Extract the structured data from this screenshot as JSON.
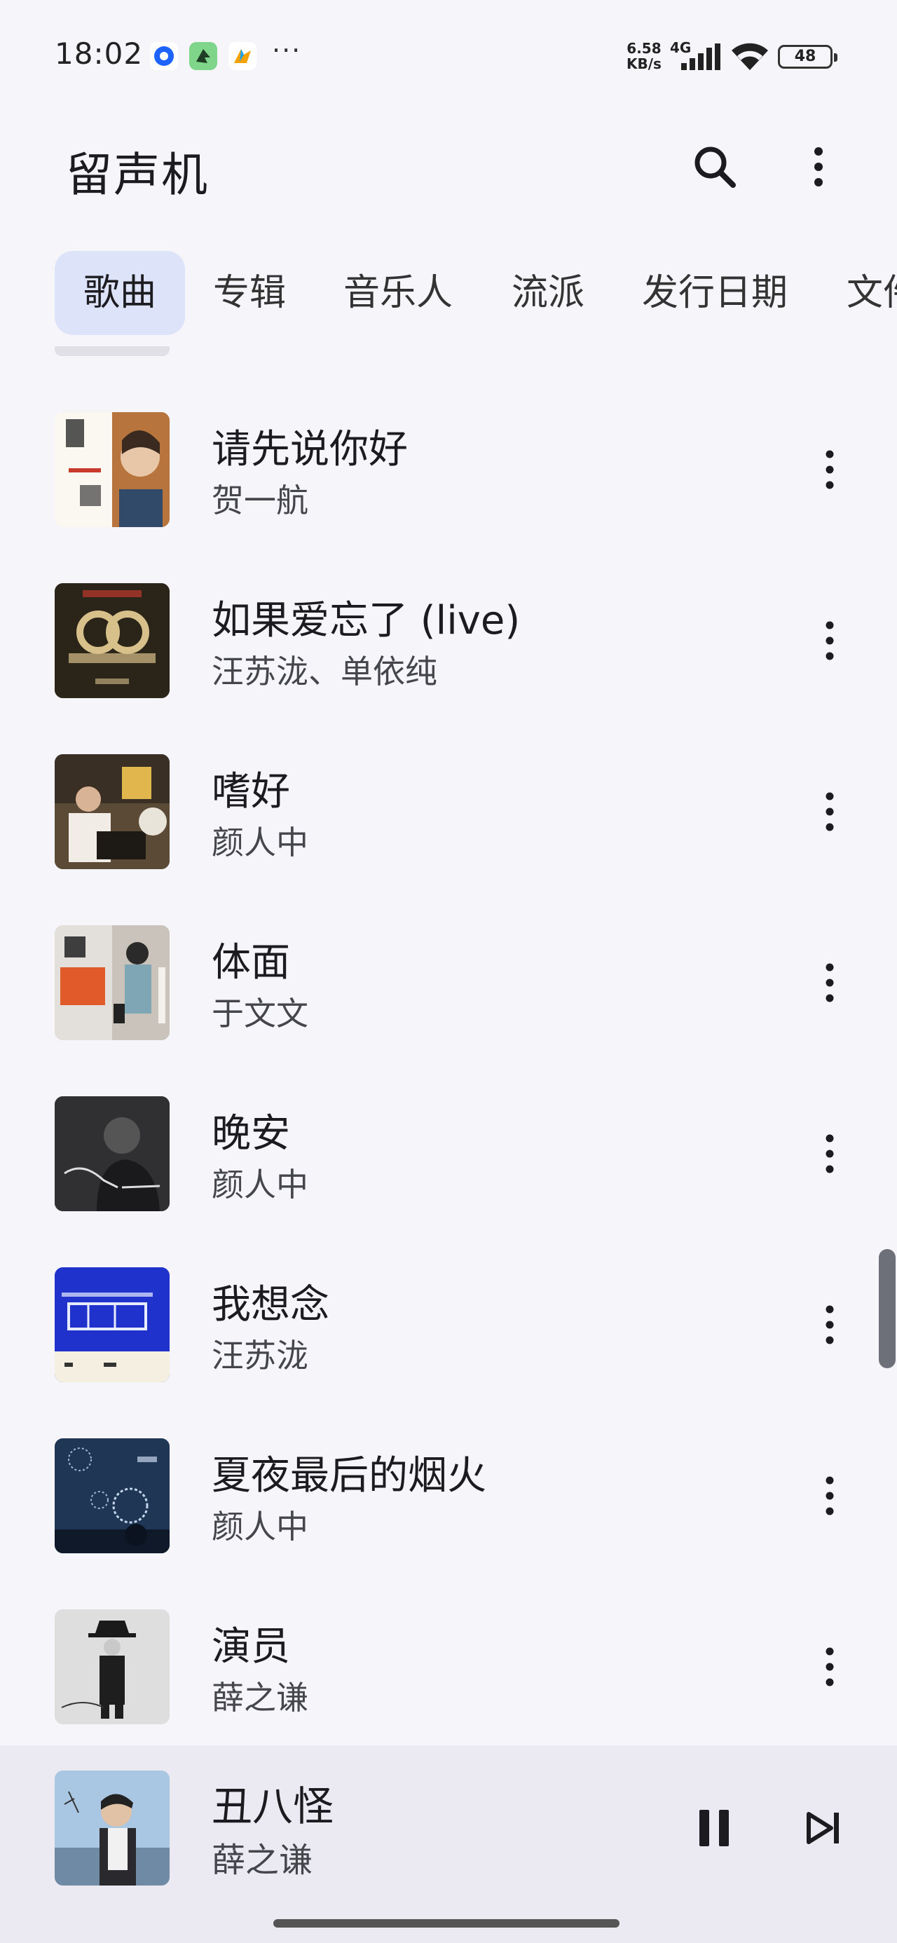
{
  "status_bar": {
    "time": "18:02",
    "net_speed_value": "6.58",
    "net_speed_unit": "KB/s",
    "network_type": "4G",
    "battery": "48",
    "overflow_dots": "···"
  },
  "header": {
    "title": "留声机",
    "search_icon": "search-icon",
    "more_icon": "more-vert-icon"
  },
  "tabs": [
    {
      "label": "歌曲",
      "active": true
    },
    {
      "label": "专辑",
      "active": false
    },
    {
      "label": "音乐人",
      "active": false
    },
    {
      "label": "流派",
      "active": false
    },
    {
      "label": "发行日期",
      "active": false
    },
    {
      "label": "文件夹",
      "active": false
    }
  ],
  "songs": [
    {
      "title": "请先说你好",
      "artist": "贺一航",
      "cover_color": "#e8c9a3"
    },
    {
      "title": "如果爱忘了 (live)",
      "artist": "汪苏泷、单依纯",
      "cover_color": "#2a2418"
    },
    {
      "title": "嗜好",
      "artist": "颜人中",
      "cover_color": "#5a4a36"
    },
    {
      "title": "体面",
      "artist": "于文文",
      "cover_color": "#d9d5cf"
    },
    {
      "title": "晚安",
      "artist": "颜人中",
      "cover_color": "#2d2d30"
    },
    {
      "title": "我想念",
      "artist": "汪苏泷",
      "cover_color": "#1c2fc8"
    },
    {
      "title": "夏夜最后的烟火",
      "artist": "颜人中",
      "cover_color": "#213a58"
    },
    {
      "title": "演员",
      "artist": "薛之谦",
      "cover_color": "#d6d6d6"
    }
  ],
  "now_playing": {
    "title": "丑八怪",
    "artist": "薛之谦",
    "cover_color": "#8fb3d6",
    "pause_icon": "pause-icon",
    "next_icon": "skip-next-icon"
  },
  "colors": {
    "background": "#f6f5fa",
    "active_tab": "#dde3f8",
    "now_playing_bar": "#ebeaf2"
  }
}
